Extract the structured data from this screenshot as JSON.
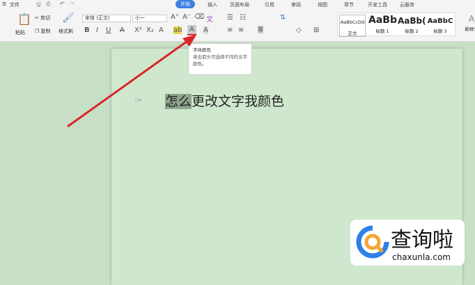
{
  "menu": {
    "file": "文件"
  },
  "tabs": [
    "开始",
    "插入",
    "页面布局",
    "引用",
    "审阅",
    "视图",
    "章节",
    "开发工具",
    "云服务"
  ],
  "clipboard": {
    "paste": "粘贴",
    "cut": "剪切",
    "copy": "复制",
    "format_painter": "格式刷"
  },
  "font": {
    "name": "宋体 (正文)",
    "size": "小一"
  },
  "styles": [
    {
      "sample": "AaBbCcDd",
      "label": "正文"
    },
    {
      "sample": "AaBb",
      "label": "标题 1"
    },
    {
      "sample": "AaBb(",
      "label": "标题 2"
    },
    {
      "sample": "AaBbC",
      "label": "标题 3"
    },
    {
      "sample": "A",
      "label": "新样式"
    }
  ],
  "tooltip": {
    "title": "字体颜色",
    "body": "单击箭头可选择不同的文字颜色。"
  },
  "document": {
    "highlighted": "怎么",
    "rest": "更改文字我颜色"
  },
  "watermark": {
    "name": "查询啦",
    "url": "chaxunla.com"
  },
  "colors": {
    "accent": "#3d7fe0",
    "arrow": "#d9252a",
    "page": "#cfe8cd"
  }
}
